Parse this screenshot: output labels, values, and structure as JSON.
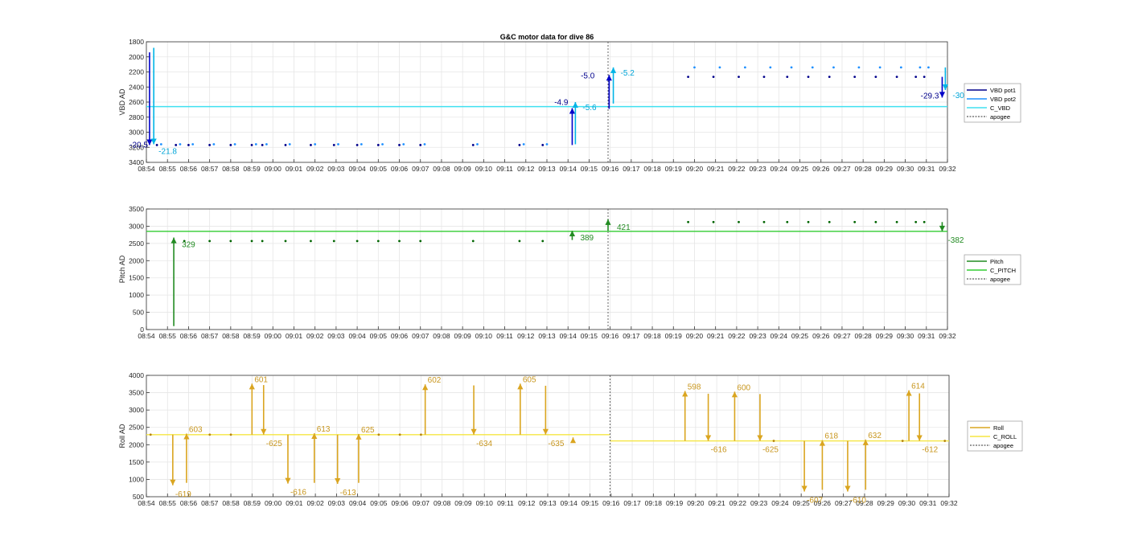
{
  "title": "G&C motor data for dive 86",
  "time_ticks": [
    "08:54",
    "08:55",
    "08:56",
    "08:57",
    "08:58",
    "08:59",
    "09:00",
    "09:01",
    "09:02",
    "09:03",
    "09:04",
    "09:05",
    "09:06",
    "09:07",
    "09:08",
    "09:09",
    "09:10",
    "09:11",
    "09:12",
    "09:13",
    "09:14",
    "09:15",
    "09:16",
    "09:17",
    "09:18",
    "09:19",
    "09:20",
    "09:21",
    "09:22",
    "09:23",
    "09:24",
    "09:25",
    "09:26",
    "09:27",
    "09:28",
    "09:29",
    "09:30",
    "09:31",
    "09:32"
  ],
  "chart_data": [
    {
      "type": "scatter",
      "id": "vbd",
      "ylabel": "VBD AD",
      "ylim": [
        1800,
        3400
      ],
      "y_reversed": true,
      "yticks": [
        1800,
        2000,
        2200,
        2400,
        2600,
        2800,
        3000,
        3200,
        3400
      ],
      "grid": true,
      "legend_placement": "outside-right",
      "legend": [
        "VBD pot1",
        "VBD pot2",
        "C_VBD",
        "apogee"
      ],
      "colors": {
        "pot1": "#00008b",
        "pot2": "#1e90ff",
        "c_line": "#40e0f0",
        "arrow1": "#0000c8",
        "arrow2": "#00b4e6",
        "apogee": "#555555"
      },
      "apogee_min": 21.9,
      "c_vbd": 2660,
      "pot1_points": [
        [
          0.5,
          3170
        ],
        [
          1.4,
          3170
        ],
        [
          2.0,
          3170
        ],
        [
          3.0,
          3170
        ],
        [
          4.0,
          3170
        ],
        [
          5.0,
          3170
        ],
        [
          5.5,
          3170
        ],
        [
          6.6,
          3170
        ],
        [
          7.8,
          3170
        ],
        [
          8.9,
          3170
        ],
        [
          10.0,
          3170
        ],
        [
          11.0,
          3170
        ],
        [
          12.0,
          3170
        ],
        [
          13.0,
          3170
        ],
        [
          15.5,
          3170
        ],
        [
          17.7,
          3170
        ],
        [
          18.8,
          3170
        ],
        [
          25.7,
          2265
        ],
        [
          26.9,
          2265
        ],
        [
          28.1,
          2265
        ],
        [
          29.3,
          2265
        ],
        [
          30.4,
          2265
        ],
        [
          31.4,
          2265
        ],
        [
          32.4,
          2265
        ],
        [
          33.6,
          2265
        ],
        [
          34.6,
          2265
        ],
        [
          35.6,
          2265
        ],
        [
          36.5,
          2265
        ],
        [
          36.9,
          2265
        ]
      ],
      "pot2_points": [
        [
          0.7,
          3160
        ],
        [
          1.6,
          3160
        ],
        [
          2.2,
          3160
        ],
        [
          3.2,
          3160
        ],
        [
          4.2,
          3160
        ],
        [
          5.2,
          3160
        ],
        [
          5.7,
          3160
        ],
        [
          6.8,
          3160
        ],
        [
          8.0,
          3160
        ],
        [
          9.1,
          3160
        ],
        [
          10.2,
          3160
        ],
        [
          11.2,
          3160
        ],
        [
          12.2,
          3160
        ],
        [
          13.2,
          3160
        ],
        [
          15.7,
          3160
        ],
        [
          17.9,
          3160
        ],
        [
          19.0,
          3160
        ],
        [
          26.0,
          2140
        ],
        [
          27.2,
          2140
        ],
        [
          28.4,
          2140
        ],
        [
          29.6,
          2140
        ],
        [
          30.6,
          2140
        ],
        [
          31.6,
          2140
        ],
        [
          32.6,
          2140
        ],
        [
          33.8,
          2140
        ],
        [
          34.8,
          2140
        ],
        [
          35.8,
          2140
        ],
        [
          36.7,
          2140
        ],
        [
          37.1,
          2140
        ]
      ],
      "arrows": [
        {
          "x": 0.15,
          "y_from": 1940,
          "y_to": 3170,
          "series": "pot1",
          "label": "-20.5",
          "label_side": "left"
        },
        {
          "x": 0.35,
          "y_from": 1880,
          "y_to": 3160,
          "series": "pot2",
          "label": "-21.8",
          "label_side": "right-below"
        },
        {
          "x": 20.2,
          "y_from": 3170,
          "y_to": 2680,
          "series": "pot1",
          "label": "-4.9",
          "label_side": "left"
        },
        {
          "x": 20.35,
          "y_from": 3160,
          "y_to": 2600,
          "series": "pot2",
          "label": "-5.6",
          "label_side": "right"
        },
        {
          "x": 21.95,
          "y_from": 2690,
          "y_to": 2240,
          "series": "pot1",
          "label": "-5.0",
          "label_side": "left-above"
        },
        {
          "x": 22.15,
          "y_from": 2620,
          "y_to": 2140,
          "series": "pot2",
          "label": "-5.2",
          "label_side": "right"
        },
        {
          "x": 37.75,
          "y_from": 2265,
          "y_to": 2540,
          "series": "pot1",
          "label": "-29.3",
          "label_side": "left"
        },
        {
          "x": 37.9,
          "y_from": 2140,
          "y_to": 2440,
          "series": "pot2",
          "label": "-30.",
          "label_side": "right"
        }
      ]
    },
    {
      "type": "scatter",
      "id": "pitch",
      "ylabel": "Pitch AD",
      "ylim": [
        0,
        3500
      ],
      "y_reversed": false,
      "yticks": [
        0,
        500,
        1000,
        1500,
        2000,
        2500,
        3000,
        3500
      ],
      "grid": true,
      "legend_placement": "outside-right",
      "legend": [
        "Pitch",
        "C_PITCH",
        "apogee"
      ],
      "colors": {
        "points": "#006400",
        "c_line": "#32cd32",
        "arrow": "#228b22",
        "apogee": "#555555"
      },
      "apogee_min": 21.9,
      "c_pitch": 2850,
      "points": [
        [
          1.8,
          2570
        ],
        [
          3.0,
          2570
        ],
        [
          4.0,
          2570
        ],
        [
          5.0,
          2570
        ],
        [
          5.5,
          2570
        ],
        [
          6.6,
          2570
        ],
        [
          7.8,
          2570
        ],
        [
          8.9,
          2570
        ],
        [
          10.0,
          2570
        ],
        [
          11.0,
          2570
        ],
        [
          12.0,
          2570
        ],
        [
          13.0,
          2570
        ],
        [
          15.5,
          2570
        ],
        [
          17.7,
          2570
        ],
        [
          18.8,
          2570
        ],
        [
          25.7,
          3120
        ],
        [
          26.9,
          3120
        ],
        [
          28.1,
          3120
        ],
        [
          29.3,
          3120
        ],
        [
          30.4,
          3120
        ],
        [
          31.4,
          3120
        ],
        [
          32.4,
          3120
        ],
        [
          33.6,
          3120
        ],
        [
          34.6,
          3120
        ],
        [
          35.6,
          3120
        ],
        [
          36.5,
          3120
        ],
        [
          36.9,
          3120
        ]
      ],
      "arrows": [
        {
          "x": 1.3,
          "y_from": 100,
          "y_to": 2670,
          "label": "329"
        },
        {
          "x": 20.2,
          "y_from": 2600,
          "y_to": 2870,
          "label": "389"
        },
        {
          "x": 21.9,
          "y_from": 2870,
          "y_to": 3200,
          "label": "421"
        },
        {
          "x": 37.75,
          "y_from": 3120,
          "y_to": 2850,
          "label": "-382"
        }
      ]
    },
    {
      "type": "scatter",
      "id": "roll",
      "ylabel": "Roll AD",
      "ylim": [
        500,
        4000
      ],
      "y_reversed": false,
      "yticks": [
        500,
        1000,
        1500,
        2000,
        2500,
        3000,
        3500,
        4000
      ],
      "grid": true,
      "legend_placement": "outside-right",
      "legend": [
        "Roll",
        "C_ROLL",
        "apogee"
      ],
      "colors": {
        "points": "#b8860b",
        "c_line": "#f5e642",
        "arrow": "#daa520",
        "apogee": "#555555"
      },
      "apogee_min": 21.95,
      "c_roll_before": 2290,
      "c_roll_after": 2110,
      "points": [
        [
          0.2,
          2290
        ],
        [
          3.0,
          2290
        ],
        [
          4.0,
          2290
        ],
        [
          11.0,
          2290
        ],
        [
          12.0,
          2290
        ],
        [
          13.0,
          2290
        ],
        [
          29.7,
          2110
        ],
        [
          35.8,
          2110
        ],
        [
          37.8,
          2110
        ]
      ],
      "arrows": [
        {
          "x": 1.25,
          "y_from": 2290,
          "y_to": 830,
          "label": "-619"
        },
        {
          "x": 1.9,
          "y_from": 900,
          "y_to": 2320,
          "label": "603"
        },
        {
          "x": 5.0,
          "y_from": 2290,
          "y_to": 3760,
          "label": "601"
        },
        {
          "x": 5.55,
          "y_from": 3720,
          "y_to": 2290,
          "label": "-625"
        },
        {
          "x": 6.7,
          "y_from": 2290,
          "y_to": 880,
          "label": "-616"
        },
        {
          "x": 7.95,
          "y_from": 900,
          "y_to": 2330,
          "label": "613"
        },
        {
          "x": 9.05,
          "y_from": 2290,
          "y_to": 870,
          "label": "-613"
        },
        {
          "x": 10.05,
          "y_from": 900,
          "y_to": 2310,
          "label": "625"
        },
        {
          "x": 13.2,
          "y_from": 2290,
          "y_to": 3740,
          "label": "602"
        },
        {
          "x": 15.5,
          "y_from": 3710,
          "y_to": 2290,
          "label": "-634"
        },
        {
          "x": 17.7,
          "y_from": 2290,
          "y_to": 3760,
          "label": "605"
        },
        {
          "x": 18.9,
          "y_from": 3700,
          "y_to": 2290,
          "label": "-635"
        },
        {
          "x": 20.2,
          "y_from": 2110,
          "y_to": 2210,
          "label": ""
        },
        {
          "x": 25.5,
          "y_from": 2110,
          "y_to": 3550,
          "label": "598"
        },
        {
          "x": 26.6,
          "y_from": 3470,
          "y_to": 2110,
          "label": "-616"
        },
        {
          "x": 27.85,
          "y_from": 2110,
          "y_to": 3530,
          "label": "600"
        },
        {
          "x": 29.05,
          "y_from": 3460,
          "y_to": 2110,
          "label": "-625"
        },
        {
          "x": 31.15,
          "y_from": 2110,
          "y_to": 650,
          "label": "-607"
        },
        {
          "x": 32.0,
          "y_from": 700,
          "y_to": 2130,
          "label": "618"
        },
        {
          "x": 33.2,
          "y_from": 2110,
          "y_to": 650,
          "label": "-610"
        },
        {
          "x": 34.05,
          "y_from": 700,
          "y_to": 2150,
          "label": "632"
        },
        {
          "x": 36.1,
          "y_from": 2110,
          "y_to": 3570,
          "label": "614"
        },
        {
          "x": 36.6,
          "y_from": 3480,
          "y_to": 2110,
          "label": "-612"
        }
      ]
    }
  ]
}
